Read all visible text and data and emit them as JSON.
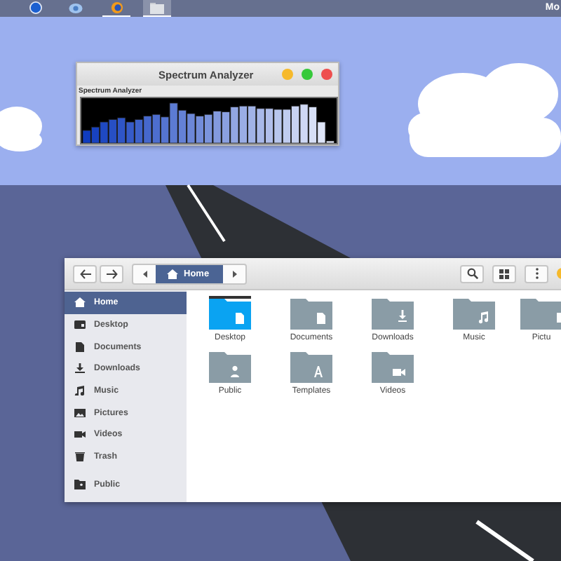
{
  "panel": {
    "launchers": [
      {
        "running": false,
        "selected": false
      },
      {
        "running": false,
        "selected": false
      },
      {
        "running": true,
        "selected": false
      },
      {
        "running": true,
        "selected": true
      }
    ],
    "clock": "Mo"
  },
  "spectrum_window": {
    "title": "Spectrum Analyzer",
    "label": "Spectrum Analyzer"
  },
  "file_manager": {
    "path": "Home",
    "sidebar": {
      "places": [
        {
          "label": "Home",
          "selected": true
        },
        {
          "label": "Desktop",
          "selected": false
        },
        {
          "label": "Documents",
          "selected": false
        },
        {
          "label": "Downloads",
          "selected": false
        },
        {
          "label": "Music",
          "selected": false
        },
        {
          "label": "Pictures",
          "selected": false
        },
        {
          "label": "Videos",
          "selected": false
        },
        {
          "label": "Trash",
          "selected": false
        }
      ],
      "other": [
        {
          "label": "Public",
          "selected": false
        }
      ]
    },
    "folders": [
      {
        "name": "Desktop",
        "color": "#0aa3f2"
      },
      {
        "name": "Documents",
        "color": "#8a9ca6"
      },
      {
        "name": "Downloads",
        "color": "#8a9ca6"
      },
      {
        "name": "Music",
        "color": "#8a9ca6"
      },
      {
        "name": "Pictu",
        "color": "#8a9ca6"
      },
      {
        "name": "Public",
        "color": "#8a9ca6"
      },
      {
        "name": "Templates",
        "color": "#8a9ca6"
      },
      {
        "name": "Videos",
        "color": "#8a9ca6"
      }
    ]
  }
}
